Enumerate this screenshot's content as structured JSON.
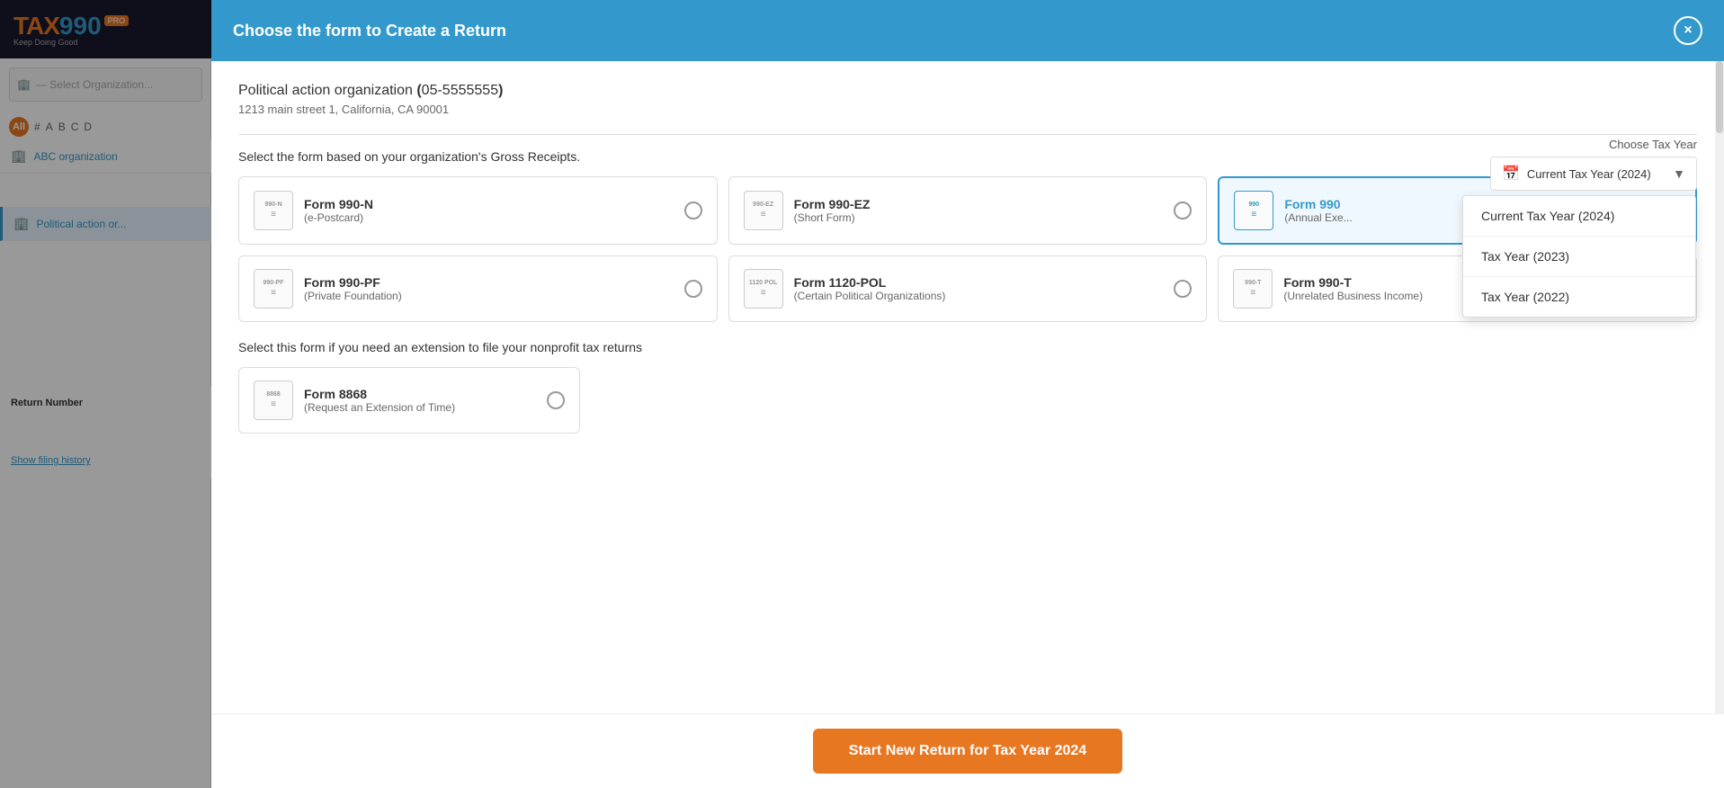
{
  "sidebar": {
    "logo": {
      "tax": "TAX",
      "num": "990",
      "pro": "PRO",
      "tagline": "Keep Doing Good"
    },
    "search_placeholder": "— Select Organization...",
    "alpha_nav": {
      "all": "All",
      "letters": [
        "#",
        "A",
        "B",
        "C",
        "D"
      ]
    },
    "organizations": [
      {
        "name": "ABC organization",
        "icon": "🏢"
      },
      {
        "name": "Political action or...",
        "icon": "🏢",
        "active": true
      }
    ],
    "return_section": {
      "label": "Return Number",
      "show_history": "Show filing history"
    }
  },
  "modal": {
    "title": "Choose the form to Create a Return",
    "close_label": "×",
    "org_name": "Political action organization",
    "org_ein": "05-5555555",
    "org_address": "1213 main street 1, California, CA 90001",
    "tax_year_section": {
      "label": "Choose Tax Year",
      "current_value": "Current Tax Year (2024)",
      "options": [
        "Current Tax Year (2024)",
        "Tax Year (2023)",
        "Tax Year (2022)"
      ]
    },
    "forms_section_label": "Select the form based on your organization's Gross Receipts.",
    "forms": [
      {
        "id": "990n",
        "icon_label": "990-N",
        "name": "Form 990-N",
        "desc": "(e-Postcard)",
        "selected": false
      },
      {
        "id": "990ez",
        "icon_label": "990-EZ",
        "name": "Form 990-EZ",
        "desc": "(Short Form)",
        "selected": false
      },
      {
        "id": "990",
        "icon_label": "990",
        "name": "Form 990",
        "desc": "(Annual Exe...",
        "selected": true
      },
      {
        "id": "990pf",
        "icon_label": "990-PF",
        "name": "Form 990-PF",
        "desc": "(Private Foundation)",
        "selected": false
      },
      {
        "id": "1120pol",
        "icon_label": "1120 POL",
        "name": "Form 1120-POL",
        "desc": "(Certain Political Organizations)",
        "selected": false
      },
      {
        "id": "990t",
        "icon_label": "990-T",
        "name": "Form 990-T",
        "desc": "(Unrelated Business Income)",
        "selected": false
      }
    ],
    "extension_section_label": "Select this form if you need an extension to file your nonprofit tax returns",
    "extension_form": {
      "id": "8868",
      "icon_label": "8868",
      "name": "Form 8868",
      "desc": "(Request an Extension of Time)",
      "selected": false
    },
    "start_button": "Start New Return for Tax Year 2024"
  }
}
